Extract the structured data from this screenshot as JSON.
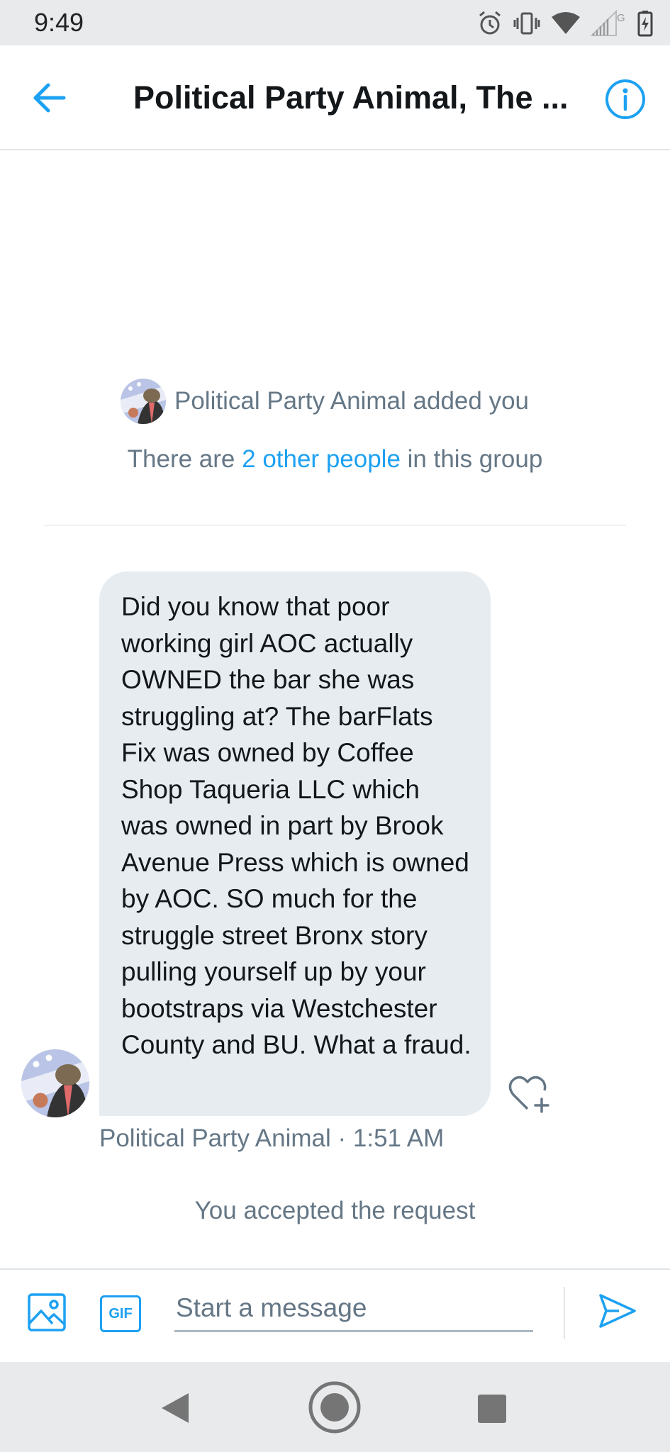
{
  "status_bar": {
    "time": "9:49",
    "icons": [
      "alarm-icon",
      "vibrate-icon",
      "wifi-icon",
      "signal-icon",
      "battery-charging-icon"
    ],
    "network_label": "G"
  },
  "header": {
    "title": "Political Party Animal, The ...",
    "back_icon": "back-arrow-icon",
    "info_icon": "info-icon"
  },
  "conversation": {
    "added_text": "Political Party Animal added you",
    "group_info": {
      "prefix": "There are ",
      "link": "2 other people",
      "suffix": " in this group"
    },
    "message": {
      "text": "Did you know that poor working girl AOC actually OWNED the bar she was struggling at? The barFlats Fix was owned by Coffee Shop Taqueria LLC which was owned in part by Brook Avenue Press which is owned by AOC. SO much for the struggle street Bronx story pulling yourself up by your bootstraps via Westchester County and BU. What a fraud.",
      "meta": "Political Party Animal · 1:51 AM"
    },
    "accepted_text": "You accepted the request"
  },
  "composer": {
    "placeholder": "Start a message",
    "gif_label": "GIF"
  },
  "colors": {
    "accent": "#1da1f2",
    "bubble": "#e6ecf0",
    "secondary_text": "#657786",
    "primary_text": "#14171a"
  }
}
